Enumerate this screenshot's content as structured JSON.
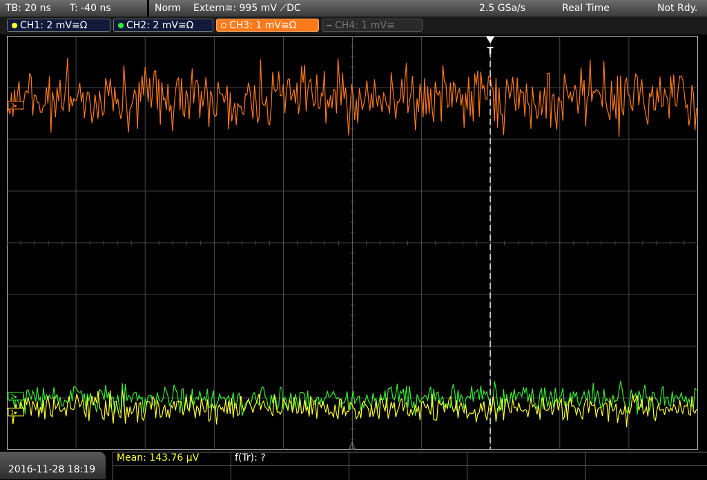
{
  "status": {
    "timebase": "TB: 20 ns",
    "trigger_time": "T: -40 ns",
    "mode": "Norm",
    "trigger_source": "Extern≅: 995 mV ⟋DC",
    "sample_rate": "2.5 GSa/s",
    "acquisition": "Real Time",
    "state": "Not Rdy."
  },
  "channels": [
    {
      "label": "CH1: 2 mV≅Ω",
      "color": "#ffff30",
      "active": true
    },
    {
      "label": "CH2: 2 mV≅Ω",
      "color": "#33ee33",
      "active": true
    },
    {
      "label": "CH3: 1 mV≅Ω",
      "color": "#ff7a1a",
      "active": true
    },
    {
      "label": "CH4: 1 mV≅",
      "color": "#777777",
      "active": false
    }
  ],
  "trigger_marker": "T",
  "offset_markers": {
    "ch3": "3▸",
    "ch2": "2▸",
    "ch1": "1▸"
  },
  "footer": {
    "datetime": "2016-11-28 18:19",
    "measurement_mean": "Mean: 143.76 µV",
    "measurement_freq": "f(Tr): ?"
  },
  "colors": {
    "ch1": "#ffff30",
    "ch2": "#33ee33",
    "ch3": "#ff7a1a",
    "grid": "#5a5a5a",
    "background": "#000000"
  }
}
